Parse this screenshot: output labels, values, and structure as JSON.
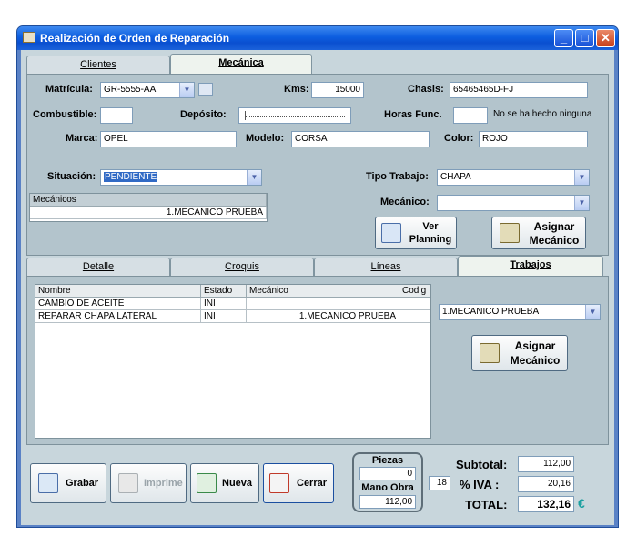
{
  "window": {
    "title": "Realización de Orden de Reparación",
    "minimize": "_",
    "maximize": "□",
    "close": "✕"
  },
  "top_tabs": [
    {
      "label": "Clientes",
      "active": false
    },
    {
      "label": "Mecánica",
      "active": true
    }
  ],
  "form": {
    "matricula_label": "Matrícula:",
    "matricula_value": "GR-5555-AA",
    "kms_label": "Kms:",
    "kms_value": "15000",
    "chasis_label": "Chasis:",
    "chasis_value": "65465465D-FJ",
    "combustible_label": "Combustible:",
    "combustible_value": "",
    "deposito_label": "Depósito:",
    "horas_label": "Horas Func.",
    "horas_value": "",
    "horas_note": "No se ha hecho ninguna",
    "marca_label": "Marca:",
    "marca_value": "OPEL",
    "modelo_label": "Modelo:",
    "modelo_value": "CORSA",
    "color_label": "Color:",
    "color_value": "ROJO",
    "situacion_label": "Situación:",
    "situacion_value": "PENDIENTE",
    "tipo_trabajo_label": "Tipo Trabajo:",
    "tipo_trabajo_value": "CHAPA",
    "mecanico_label": "Mecánico:",
    "mecanico_value": ""
  },
  "mecanicos_grid": {
    "header": "Mecánicos",
    "rows": [
      "1.MECANICO PRUEBA"
    ]
  },
  "buttons": {
    "ver_planning_line1": "Ver",
    "ver_planning_line2": "Planning",
    "asignar_mecanico_line1": "Asignar",
    "asignar_mecanico_line2": "Mecánico"
  },
  "bottom_tabs": [
    {
      "label": "Detalle",
      "active": false
    },
    {
      "label": "Croquis",
      "active": false
    },
    {
      "label": "Líneas",
      "active": false
    },
    {
      "label": "Trabajos",
      "active": true
    }
  ],
  "trabajos_grid": {
    "headers": [
      "Nombre",
      "Estado",
      "Mecánico",
      "Codig"
    ],
    "rows": [
      {
        "nombre": "CAMBIO DE ACEITE",
        "estado": "INI",
        "mecanico": "",
        "codig": ""
      },
      {
        "nombre": "REPARAR CHAPA LATERAL",
        "estado": "INI",
        "mecanico": "1.MECANICO PRUEBA",
        "codig": ""
      }
    ]
  },
  "trabajos_side": {
    "mecanico_value": "1.MECANICO PRUEBA",
    "asignar_line1": "Asignar",
    "asignar_line2": "Mecánico"
  },
  "footer": {
    "grabar": "Grabar",
    "imprime": "Imprime",
    "nueva": "Nueva",
    "cerrar": "Cerrar",
    "piezas_label": "Piezas",
    "piezas_value": "0",
    "mano_obra_label": "Mano Obra",
    "mano_obra_value": "112,00",
    "iva_rate": "18",
    "subtotal_label": "Subtotal:",
    "subtotal_value": "112,00",
    "iva_label": "% IVA :",
    "iva_value": "20,16",
    "total_label": "TOTAL:",
    "total_value": "132,16",
    "currency": "€"
  },
  "colors": {
    "title_bar": "#0d5ee0",
    "selection": "#316ac5",
    "currency": "#1aa0a0"
  }
}
